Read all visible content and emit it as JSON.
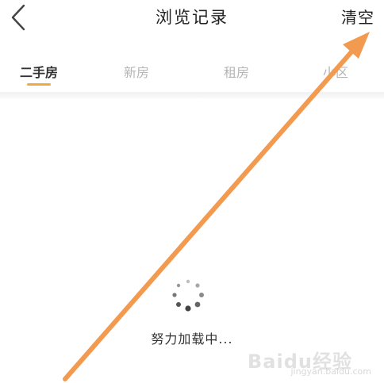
{
  "header": {
    "title": "浏览记录",
    "clear_label": "清空"
  },
  "tabs": [
    {
      "label": "二手房",
      "active": true
    },
    {
      "label": "新房",
      "active": false
    },
    {
      "label": "租房",
      "active": false
    },
    {
      "label": "小区",
      "active": false
    }
  ],
  "loading": {
    "text": "努力加载中..."
  },
  "watermark": {
    "text": "Baidu经验",
    "sub": "jingyan.baidu.com"
  },
  "colors": {
    "accent": "#f0a93a",
    "annotation_arrow": "#f29a4f"
  },
  "icons": {
    "back": "chevron-left-icon",
    "spinner": "loading-spinner-icon"
  }
}
